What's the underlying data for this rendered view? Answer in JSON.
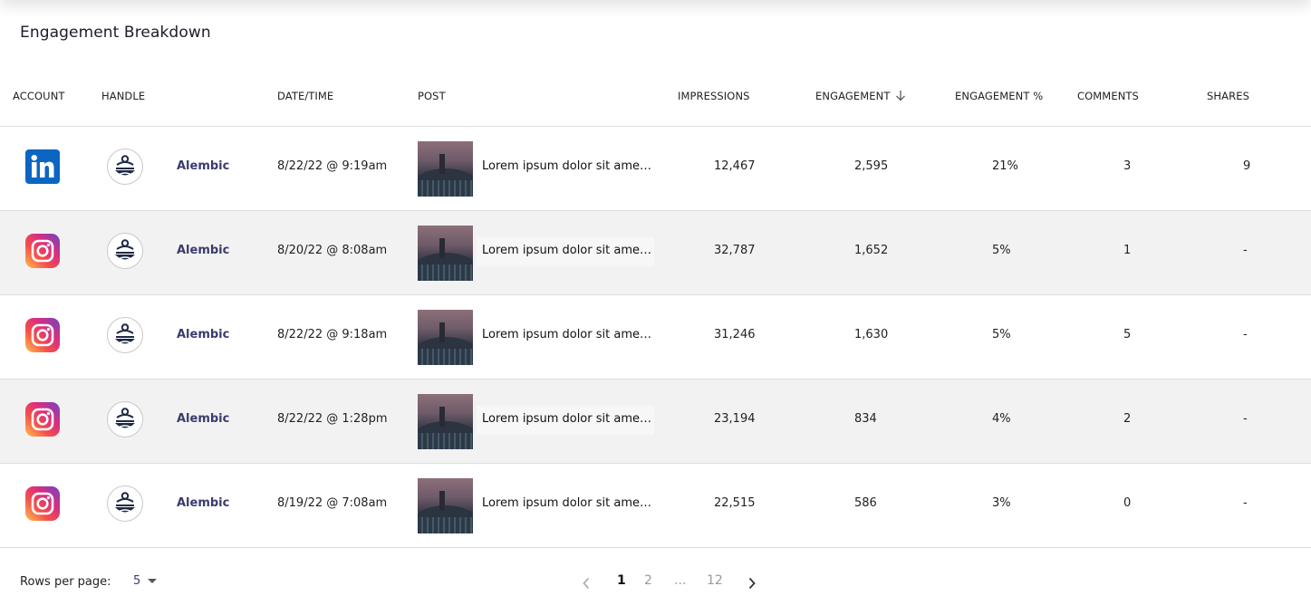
{
  "title": "Engagement Breakdown",
  "columns": {
    "account": "ACCOUNT",
    "handle": "HANDLE",
    "datetime": "DATE/TIME",
    "post": "POST",
    "impressions": "IMPRESSIONS",
    "engagement": "ENGAGEMENT",
    "engagement_pct": "ENGAGEMENT %",
    "comments": "COMMENTS",
    "shares": "SHARES"
  },
  "rows": [
    {
      "account": "linkedin-icon",
      "handle": "Alembic",
      "datetime": "8/22/22 @ 9:19am",
      "post": "Lorem ipsum dolor sit amet, consectetur",
      "impressions": "12,467",
      "engagement": "2,595",
      "engagement_pct": "21%",
      "comments": "3",
      "shares": "9"
    },
    {
      "account": "instagram-icon",
      "handle": "Alembic",
      "datetime": "8/20/22 @ 8:08am",
      "post": "Lorem ipsum dolor sit amet, consectetur",
      "impressions": "32,787",
      "engagement": "1,652",
      "engagement_pct": "5%",
      "comments": "1",
      "shares": "-"
    },
    {
      "account": "instagram-icon",
      "handle": "Alembic",
      "datetime": "8/22/22 @ 9:18am",
      "post": "Lorem ipsum dolor sit amet, consectetur",
      "impressions": "31,246",
      "engagement": "1,630",
      "engagement_pct": "5%",
      "comments": "5",
      "shares": "-"
    },
    {
      "account": "instagram-icon",
      "handle": "Alembic",
      "datetime": "8/22/22 @ 1:28pm",
      "post": "Lorem ipsum dolor sit amet, consectetur",
      "impressions": "23,194",
      "engagement": "834",
      "engagement_pct": "4%",
      "comments": "2",
      "shares": "-"
    },
    {
      "account": "instagram-icon",
      "handle": "Alembic",
      "datetime": "8/19/22 @ 7:08am",
      "post": "Lorem ipsum dolor sit amet, consectetur",
      "impressions": "22,515",
      "engagement": "586",
      "engagement_pct": "3%",
      "comments": "0",
      "shares": "-"
    }
  ],
  "footer": {
    "rows_per_page_label": "Rows per page:",
    "rows_per_page_value": "5",
    "pages": [
      "1",
      "2",
      "...",
      "12"
    ],
    "current_page": "1"
  },
  "colors": {
    "handle_text": "#3b3b6e",
    "alt_row": "#f2f2f2",
    "linkedin": "#0a66c2"
  }
}
